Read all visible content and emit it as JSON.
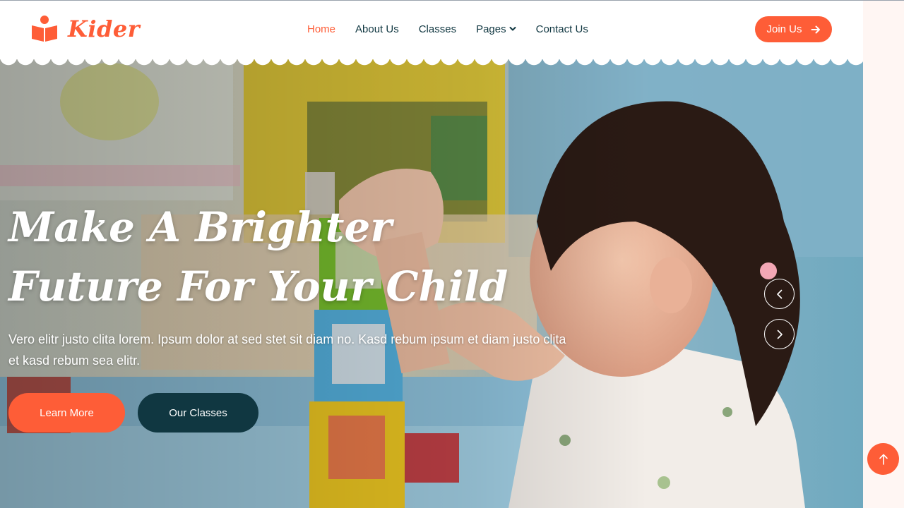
{
  "brand": {
    "name": "Kider",
    "icon": "book-reader-icon",
    "color": "#fe5d37"
  },
  "nav": {
    "items": [
      {
        "label": "Home",
        "active": true
      },
      {
        "label": "About Us"
      },
      {
        "label": "Classes"
      },
      {
        "label": "Pages",
        "dropdown": true
      },
      {
        "label": "Contact Us"
      }
    ],
    "join_label": "Join Us",
    "join_icon": "arrow-right-icon"
  },
  "hero": {
    "title": "Make A Brighter Future For Your Child",
    "description": "Vero elitr justo clita lorem. Ipsum dolor at sed stet sit diam no. Kasd rebum ipsum et diam justo clita et kasd rebum sea elitr.",
    "learn_more_label": "Learn More",
    "our_classes_label": "Our Classes",
    "prev_icon": "chevron-left-icon",
    "next_icon": "chevron-right-icon"
  },
  "colors": {
    "accent": "#fe5d37",
    "dark": "#103741",
    "back_to_top_bg": "#fe5d37"
  },
  "back_to_top_icon": "arrow-up-icon"
}
